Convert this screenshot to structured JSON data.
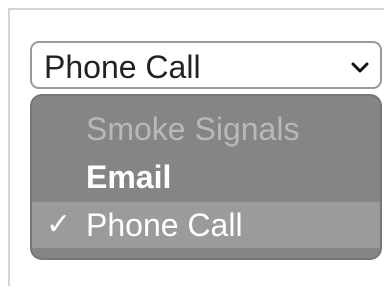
{
  "select": {
    "value": "Phone Call"
  },
  "menu": {
    "options": [
      {
        "label": "Smoke Signals",
        "state": "disabled"
      },
      {
        "label": "Email",
        "state": "enabled"
      },
      {
        "label": "Phone Call",
        "state": "selected",
        "check": "✓"
      }
    ]
  },
  "colors": {
    "menu_background": "#858585",
    "selected_row": "#9b9b9b",
    "disabled_text": "#b8b8b8"
  },
  "icons": {
    "dropdown": "chevron-down-icon",
    "selected": "checkmark-icon"
  }
}
